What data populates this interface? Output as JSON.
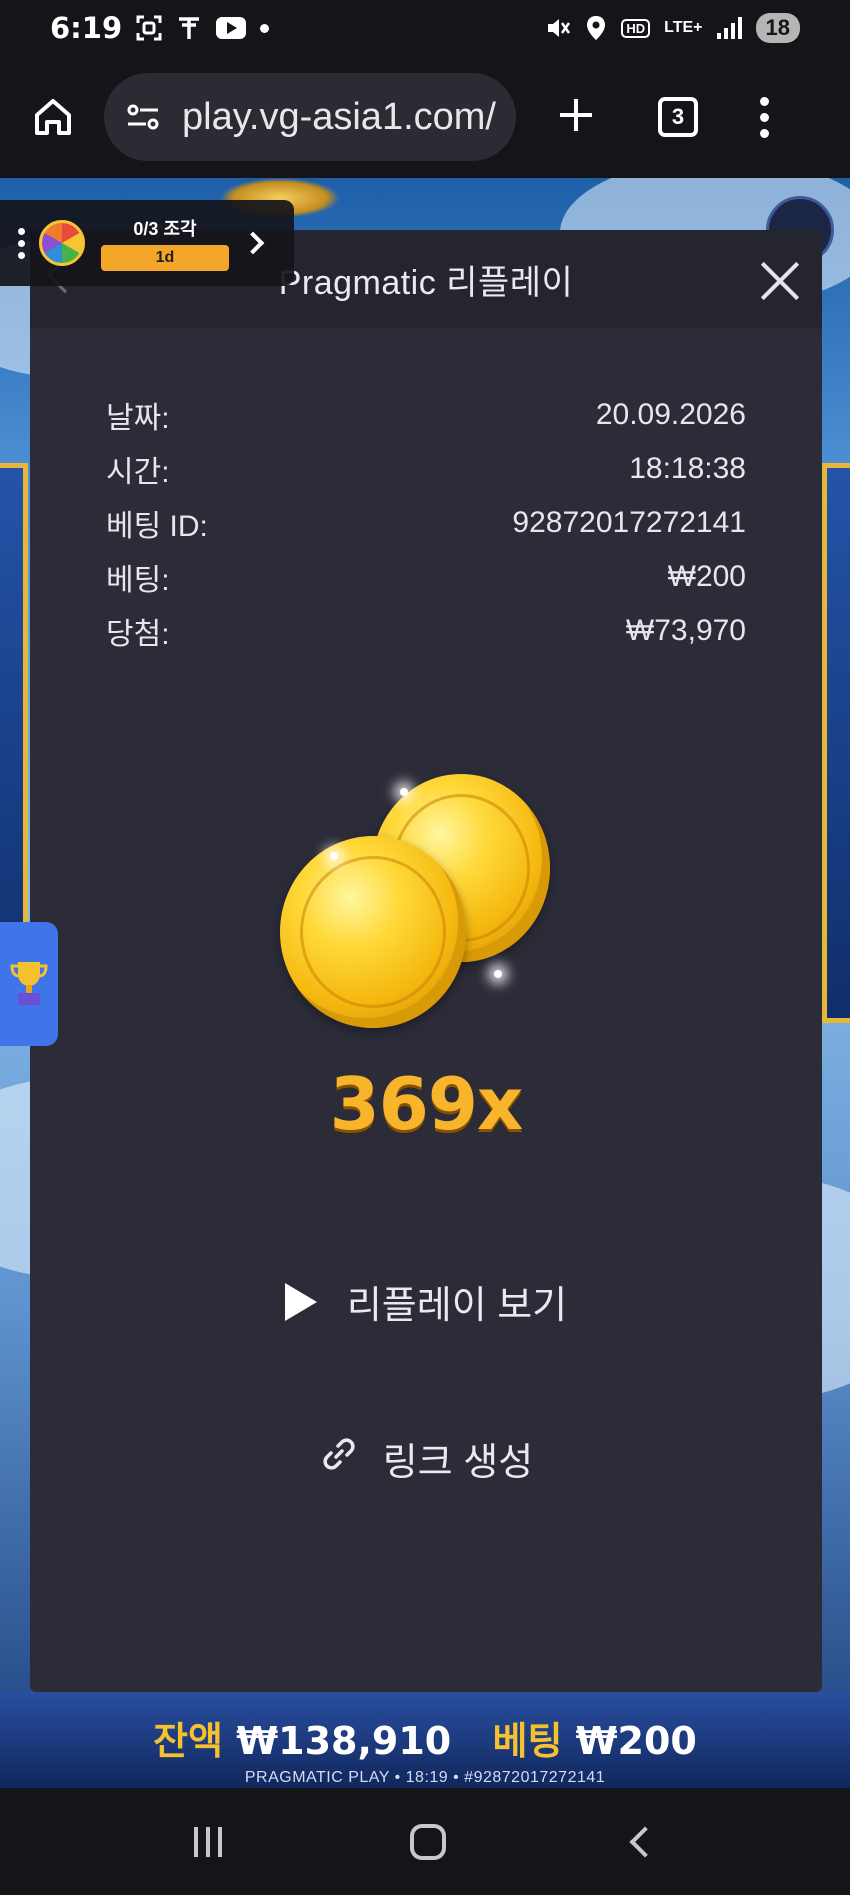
{
  "status_bar": {
    "time": "6:19",
    "network": "LTE+",
    "battery": "18"
  },
  "browser": {
    "url": "play.vg-asia1.com/",
    "tab_count": "3"
  },
  "task_widget": {
    "progress_text": "0/3 조각",
    "timer": "1d"
  },
  "modal": {
    "title": "Pragmatic 리플레이",
    "details": [
      {
        "label": "날짜:",
        "value": "20.09.2026"
      },
      {
        "label": "시간:",
        "value": "18:18:38"
      },
      {
        "label": "베팅 ID:",
        "value": "92872017272141"
      },
      {
        "label": "베팅:",
        "value": "₩200"
      },
      {
        "label": "당첨:",
        "value": "₩73,970"
      }
    ],
    "multiplier": "369x",
    "replay_label": "리플레이 보기",
    "link_label": "링크 생성"
  },
  "footer": {
    "balance_label": "잔액",
    "balance_value": "₩138,910",
    "bet_label": "베팅",
    "bet_value": "₩200",
    "sub_text": "PRAGMATIC PLAY • 18:19 • #92872017272141"
  },
  "colors": {
    "modal_bg": "#2c2c39",
    "multiplier": "#f8b52c",
    "footer_label": "#f6c12e",
    "timer_bar": "#f4a62a"
  }
}
